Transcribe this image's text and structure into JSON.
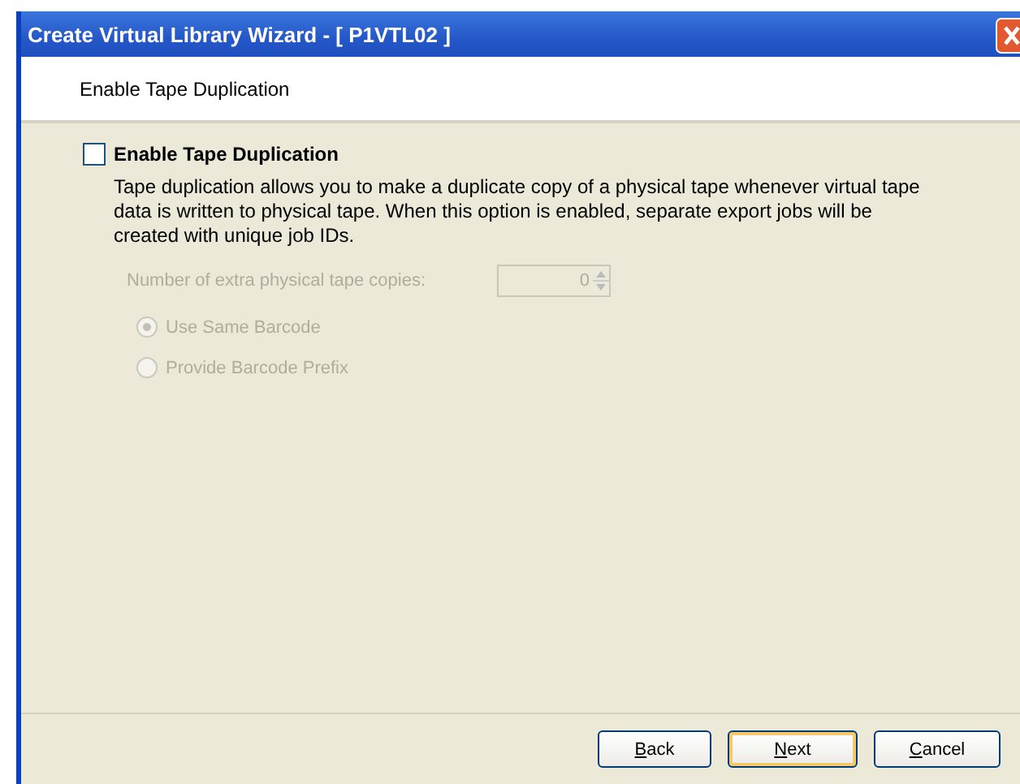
{
  "window": {
    "title": "Create Virtual Library Wizard - [ P1VTL02 ]"
  },
  "header": {
    "title": "Enable Tape Duplication"
  },
  "enable": {
    "label": "Enable Tape Duplication",
    "checked": false
  },
  "description": "Tape duplication allows you to make a duplicate copy of a physical tape whenever virtual tape data is written to physical tape. When this option is enabled, separate export jobs will be created with unique job IDs.",
  "copies": {
    "label": "Number of extra physical tape copies:",
    "value": "0",
    "disabled": true
  },
  "barcode_options": [
    {
      "label": "Use Same Barcode",
      "selected": true,
      "disabled": true
    },
    {
      "label": "Provide Barcode Prefix",
      "selected": false,
      "disabled": true
    }
  ],
  "buttons": [
    {
      "label": "Back",
      "kind": "normal"
    },
    {
      "label": "Next",
      "kind": "default"
    },
    {
      "label": "Cancel",
      "kind": "normal"
    }
  ]
}
